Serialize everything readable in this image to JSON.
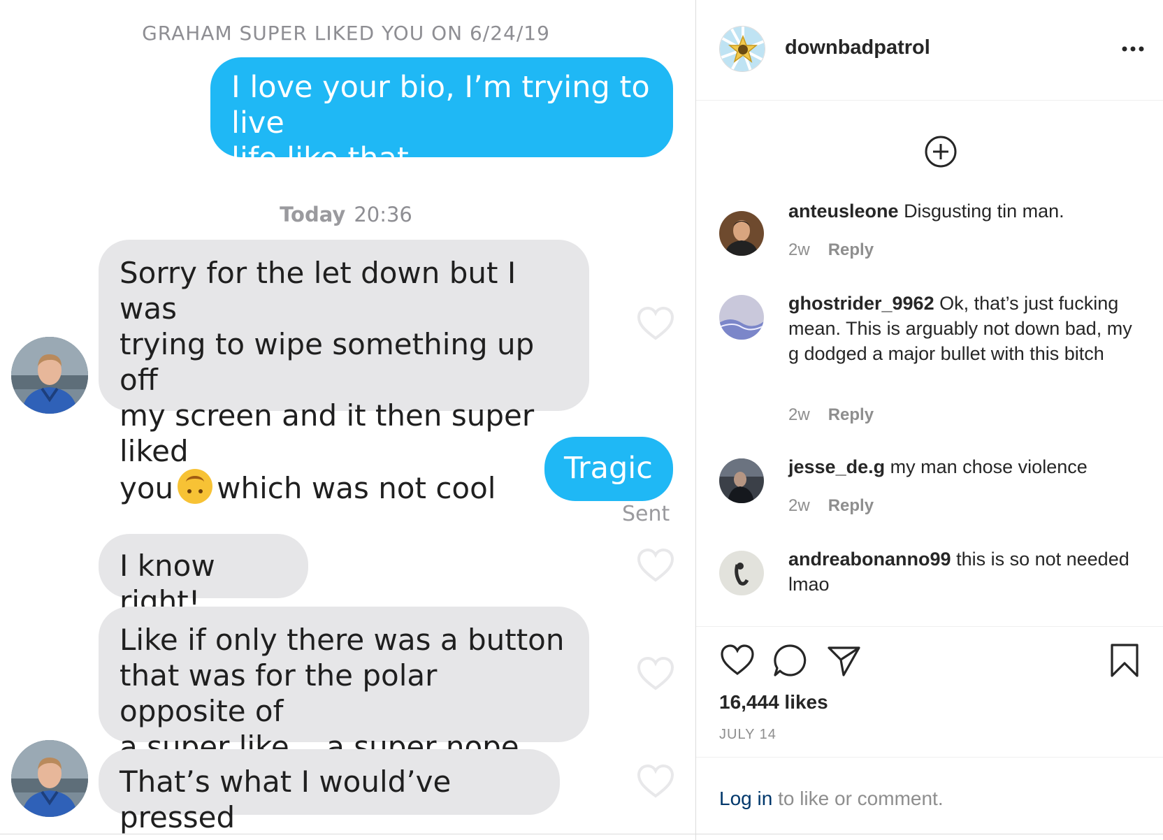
{
  "chat": {
    "superliked_banner": "GRAHAM SUPER LIKED YOU ON 6/24/19",
    "timestamp_day": "Today",
    "timestamp_time": "20:36",
    "messages": [
      {
        "direction": "out",
        "text": "I love your bio, I’m trying to live\nlife like that"
      },
      {
        "direction": "in",
        "text_before_emoji": "Sorry for the let down but I was\ntrying to wipe something up off\nmy screen and it then super liked\nyou",
        "emoji": "upside-down-face",
        "text_after_emoji": "which was not cool"
      },
      {
        "direction": "out",
        "text": "Tragic"
      },
      {
        "direction": "in",
        "text": "I know right!"
      },
      {
        "direction": "in",
        "text": "Like if only there was a button\nthat was for the polar opposite of\na super like... a super nope"
      },
      {
        "direction": "in",
        "text": "That’s what I would’ve pressed"
      }
    ],
    "sent_status": "Sent",
    "colors": {
      "outgoing": "#1fb8f5",
      "incoming": "#e6e6e8"
    }
  },
  "instagram": {
    "username": "downbadpatrol",
    "comments": [
      {
        "user": "anteusleone",
        "text": "Disgusting tin man.",
        "age": "2w",
        "reply": "Reply"
      },
      {
        "user": "ghostrider_9962",
        "text": "Ok, that’s just fucking mean. This is arguably not down bad, my g dodged a major bullet with this bitch",
        "age": "2w",
        "reply": "Reply"
      },
      {
        "user": "jesse_de.g",
        "text": "my man chose violence",
        "age": "2w",
        "reply": "Reply"
      },
      {
        "user": "andreabonanno99",
        "text": "this is so not needed lmao",
        "age": "",
        "reply": ""
      }
    ],
    "likes": "16,444 likes",
    "date": "JULY 14",
    "login_link": "Log in",
    "login_rest": " to like or comment.",
    "icons": [
      "more-icon",
      "add-circle-icon",
      "heart-icon",
      "comment-icon",
      "share-icon",
      "bookmark-icon"
    ]
  }
}
